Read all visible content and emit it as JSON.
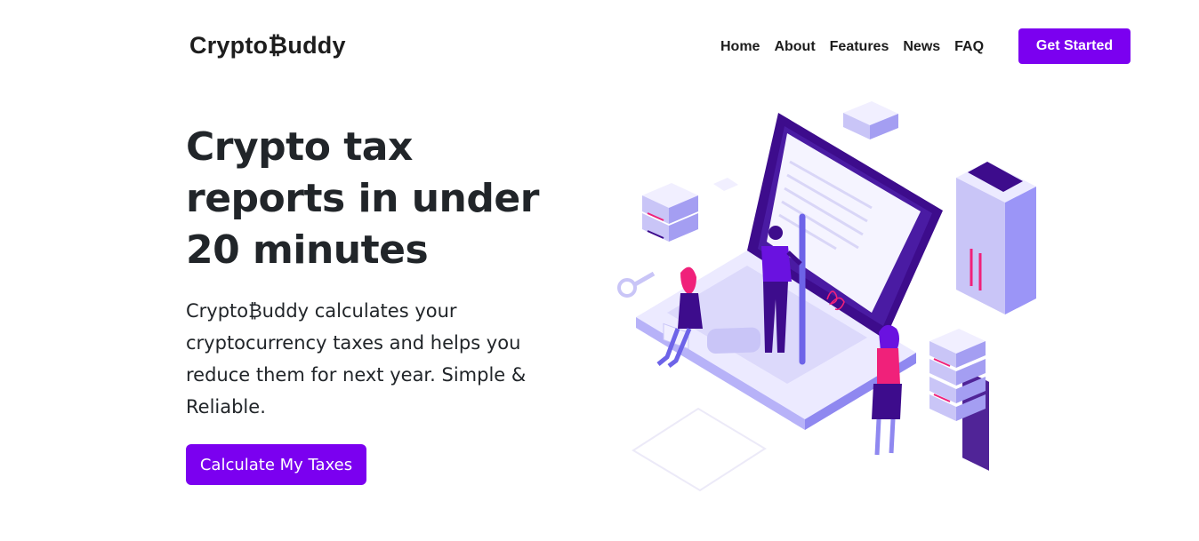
{
  "brand": {
    "name": "Crypto₿uddy"
  },
  "nav": {
    "items": [
      {
        "label": "Home"
      },
      {
        "label": "About"
      },
      {
        "label": "Features"
      },
      {
        "label": "News"
      },
      {
        "label": "FAQ"
      }
    ],
    "cta_label": "Get Started"
  },
  "hero": {
    "title": "Crypto tax reports in under 20 minutes",
    "description": "Crypto₿uddy calculates your cryptocurrency taxes and helps you reduce them for next year. Simple & Reliable.",
    "cta_label": "Calculate My Taxes"
  },
  "colors": {
    "accent": "#7b00f0",
    "illustration_primary": "#9b95f7",
    "illustration_dark": "#3d0c8c",
    "illustration_pink": "#f0217a"
  },
  "illustration": {
    "icon": "isometric-laptop-tax-illustration"
  }
}
